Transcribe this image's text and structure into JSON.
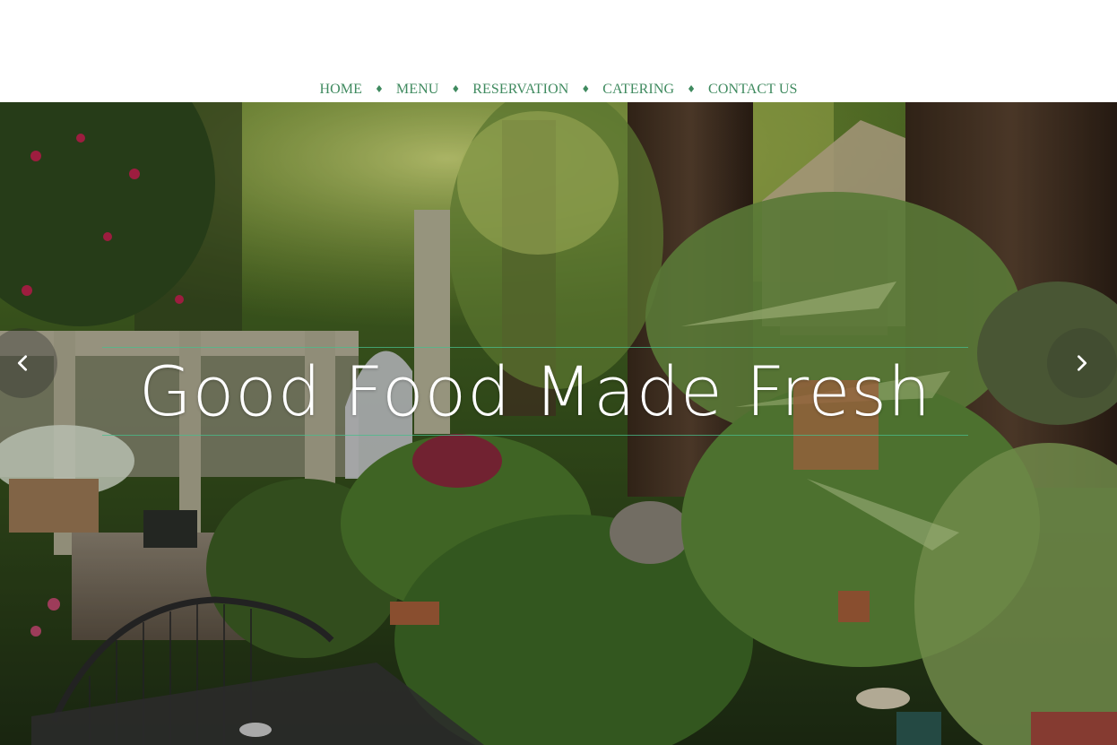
{
  "nav": {
    "items": [
      {
        "label": "HOME"
      },
      {
        "label": "MENU"
      },
      {
        "label": "RESERVATION"
      },
      {
        "label": "CATERING"
      },
      {
        "label": "CONTACT US"
      }
    ],
    "separator": "♦"
  },
  "hero": {
    "title": "Good Food Made Fresh",
    "prev_icon": "chevron-left-icon",
    "next_icon": "chevron-right-icon"
  },
  "colors": {
    "nav_text": "#3f8a5f",
    "title_rule": "#48be8c",
    "title_text": "#ffffff"
  }
}
